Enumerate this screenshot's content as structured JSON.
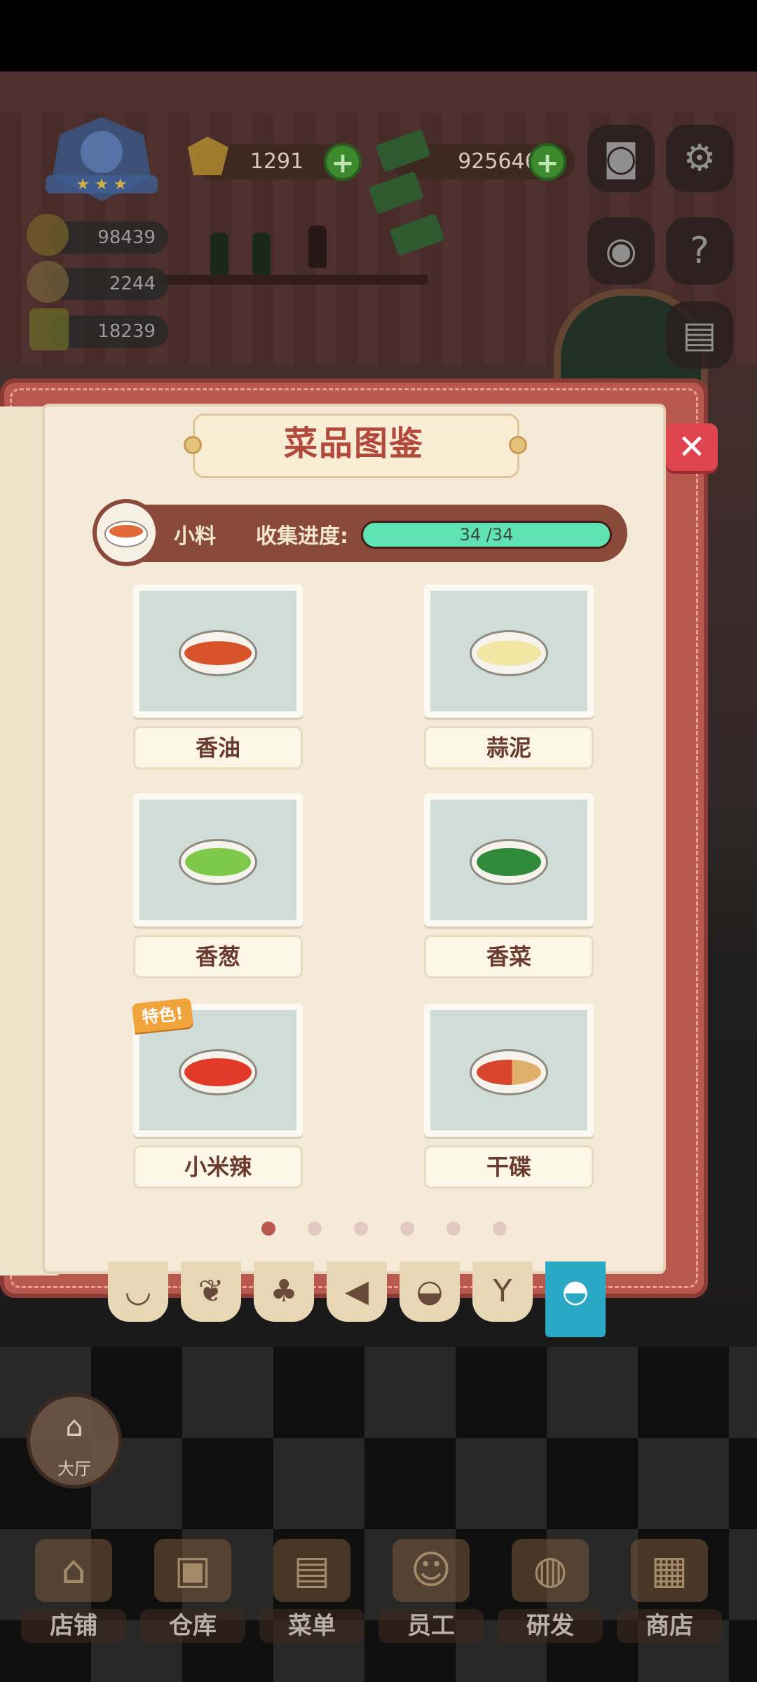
{
  "hud": {
    "gem_count": "1291",
    "cash_count": "9256465",
    "stats": [
      "98439",
      "2244",
      "18239"
    ]
  },
  "dialog": {
    "title": "菜品图鉴",
    "close_icon": "✕",
    "category": "小料",
    "progress_label": "收集进度:",
    "progress_text": "34 /34",
    "progress_fraction": 1.0,
    "dishes": [
      {
        "name": "香油",
        "icon": "sesame-oil-dish"
      },
      {
        "name": "蒜泥",
        "icon": "garlic-paste-dish"
      },
      {
        "name": "香葱",
        "icon": "green-onion-dish"
      },
      {
        "name": "香菜",
        "icon": "coriander-dish"
      },
      {
        "name": "小米辣",
        "icon": "chili-dish",
        "badge": "特色!"
      },
      {
        "name": "干碟",
        "icon": "dry-dip-dish"
      }
    ],
    "page_count": 6,
    "current_page": 1,
    "tabs": [
      "wok-icon",
      "drumstick-icon",
      "broccoli-icon",
      "fish-icon",
      "bread-icon",
      "wine-glass-icon",
      "sauce-bowl-icon"
    ],
    "active_tab": 6
  },
  "hall": {
    "label": "大厅"
  },
  "bottom_nav": [
    {
      "label": "店铺"
    },
    {
      "label": "仓库"
    },
    {
      "label": "菜单"
    },
    {
      "label": "员工"
    },
    {
      "label": "研发"
    },
    {
      "label": "商店"
    }
  ],
  "colors": {
    "accent": "#b8584f",
    "progress": "#5fe3b4",
    "active_tab": "#2aa8c4",
    "close": "#e0454f"
  }
}
